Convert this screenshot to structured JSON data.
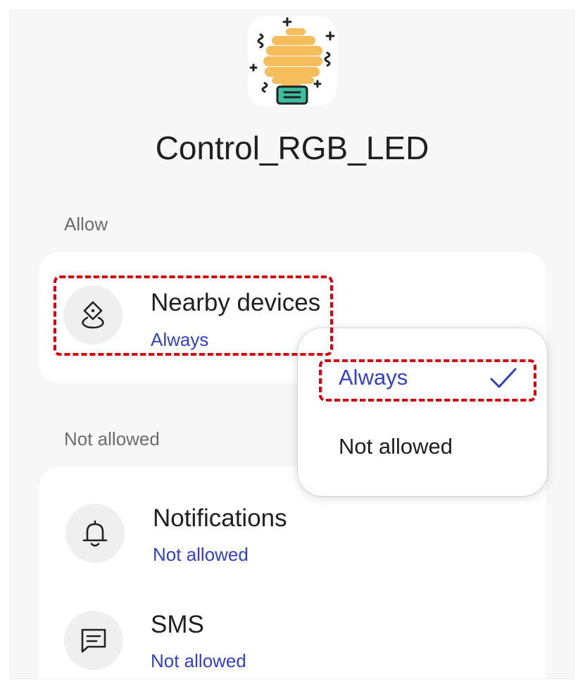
{
  "app": {
    "name": "Control_RGB_LED",
    "icon": "light-bulb-icon"
  },
  "sections": {
    "allowed_header": "Allow",
    "not_allowed_header": "Not allowed"
  },
  "permissions": [
    {
      "icon": "nearby-devices-icon",
      "title": "Nearby devices",
      "status": "Always"
    },
    {
      "icon": "bell-icon",
      "title": "Notifications",
      "status": "Not allowed"
    },
    {
      "icon": "message-icon",
      "title": "SMS",
      "status": "Not allowed"
    }
  ],
  "popup": {
    "options": [
      {
        "label": "Always",
        "selected": true
      },
      {
        "label": "Not allowed",
        "selected": false
      }
    ]
  },
  "colors": {
    "accent": "#3340cc",
    "highlight": "#d9000d",
    "bulb": "#f6bd5c",
    "bulb_base": "#3bbf9f"
  }
}
